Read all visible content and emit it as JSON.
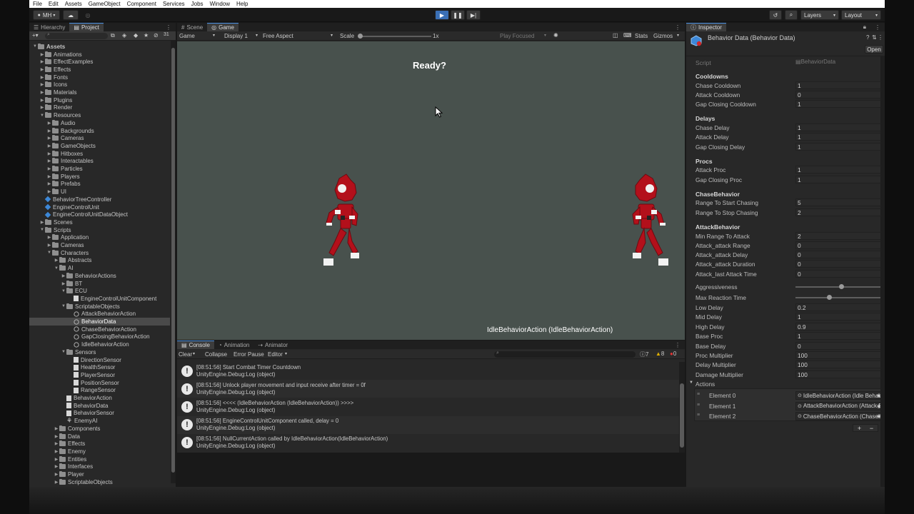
{
  "menu": [
    "File",
    "Edit",
    "Assets",
    "GameObject",
    "Component",
    "Services",
    "Jobs",
    "Window",
    "Help"
  ],
  "toolbar": {
    "account": "MH",
    "layers": "Layers",
    "layout": "Layout"
  },
  "left_tabs": {
    "hierarchy": "Hierarchy",
    "project": "Project"
  },
  "project_count": "31",
  "tree": [
    {
      "label": "Assets",
      "d": 0,
      "open": true,
      "icon": "folder",
      "bold": true
    },
    {
      "label": "Animations",
      "d": 1,
      "icon": "folder"
    },
    {
      "label": "EffectExamples",
      "d": 1,
      "icon": "folder"
    },
    {
      "label": "Effects",
      "d": 1,
      "icon": "folder"
    },
    {
      "label": "Fonts",
      "d": 1,
      "icon": "folder"
    },
    {
      "label": "Icons",
      "d": 1,
      "icon": "folder"
    },
    {
      "label": "Materials",
      "d": 1,
      "icon": "folder"
    },
    {
      "label": "Plugins",
      "d": 1,
      "icon": "folder"
    },
    {
      "label": "Render",
      "d": 1,
      "icon": "folder"
    },
    {
      "label": "Resources",
      "d": 1,
      "open": true,
      "icon": "folder"
    },
    {
      "label": "Audio",
      "d": 2,
      "icon": "folder"
    },
    {
      "label": "Backgrounds",
      "d": 2,
      "icon": "folder"
    },
    {
      "label": "Cameras",
      "d": 2,
      "icon": "folder"
    },
    {
      "label": "GameObjects",
      "d": 2,
      "icon": "folder"
    },
    {
      "label": "Hitboxes",
      "d": 2,
      "icon": "folder"
    },
    {
      "label": "Interactables",
      "d": 2,
      "icon": "folder"
    },
    {
      "label": "Particles",
      "d": 2,
      "icon": "folder"
    },
    {
      "label": "Players",
      "d": 2,
      "icon": "folder"
    },
    {
      "label": "Prefabs",
      "d": 2,
      "icon": "folder"
    },
    {
      "label": "UI",
      "d": 2,
      "icon": "folder"
    },
    {
      "label": "BehaviorTreeController",
      "d": 1,
      "icon": "cube",
      "leaf": true
    },
    {
      "label": "EngineControlUnit",
      "d": 1,
      "icon": "cube",
      "leaf": true
    },
    {
      "label": "EngineControlUnitDataObject",
      "d": 1,
      "icon": "cube",
      "leaf": true
    },
    {
      "label": "Scenes",
      "d": 1,
      "icon": "folder"
    },
    {
      "label": "Scripts",
      "d": 1,
      "open": true,
      "icon": "folder"
    },
    {
      "label": "Application",
      "d": 2,
      "icon": "folder"
    },
    {
      "label": "Cameras",
      "d": 2,
      "icon": "folder"
    },
    {
      "label": "Characters",
      "d": 2,
      "open": true,
      "icon": "folder"
    },
    {
      "label": "Abstracts",
      "d": 3,
      "icon": "folder"
    },
    {
      "label": "AI",
      "d": 3,
      "open": true,
      "icon": "folder"
    },
    {
      "label": "BehaviorActions",
      "d": 4,
      "icon": "folder"
    },
    {
      "label": "BT",
      "d": 4,
      "icon": "folder"
    },
    {
      "label": "ECU",
      "d": 4,
      "open": true,
      "icon": "folder"
    },
    {
      "label": "EngineControlUnitComponent",
      "d": 5,
      "icon": "file",
      "leaf": true
    },
    {
      "label": "ScriptableObjects",
      "d": 4,
      "open": true,
      "icon": "folder"
    },
    {
      "label": "AttackBehaviorAction",
      "d": 5,
      "icon": "so",
      "leaf": true
    },
    {
      "label": "BehaviorData",
      "d": 5,
      "icon": "so",
      "leaf": true,
      "sel": true
    },
    {
      "label": "ChaseBehaviorAction",
      "d": 5,
      "icon": "so",
      "leaf": true
    },
    {
      "label": "GapClosingBehaviorAction",
      "d": 5,
      "icon": "so",
      "leaf": true
    },
    {
      "label": "IdleBehaviorAction",
      "d": 5,
      "icon": "so",
      "leaf": true
    },
    {
      "label": "Sensors",
      "d": 4,
      "open": true,
      "icon": "folder"
    },
    {
      "label": "DirectionSensor",
      "d": 5,
      "icon": "file",
      "leaf": true
    },
    {
      "label": "HealthSensor",
      "d": 5,
      "icon": "file",
      "leaf": true
    },
    {
      "label": "PlayerSensor",
      "d": 5,
      "icon": "file",
      "leaf": true
    },
    {
      "label": "PositionSensor",
      "d": 5,
      "icon": "file",
      "leaf": true
    },
    {
      "label": "RangeSensor",
      "d": 5,
      "icon": "file",
      "leaf": true
    },
    {
      "label": "BehaviorAction",
      "d": 4,
      "icon": "file",
      "leaf": true
    },
    {
      "label": "BehaviorData",
      "d": 4,
      "icon": "file",
      "leaf": true
    },
    {
      "label": "BehaviorSensor",
      "d": 4,
      "icon": "file",
      "leaf": true
    },
    {
      "label": "EnemyAI",
      "d": 4,
      "icon": "prefab",
      "leaf": true
    },
    {
      "label": "Components",
      "d": 3,
      "icon": "folder"
    },
    {
      "label": "Data",
      "d": 3,
      "icon": "folder"
    },
    {
      "label": "Effects",
      "d": 3,
      "icon": "folder"
    },
    {
      "label": "Enemy",
      "d": 3,
      "icon": "folder"
    },
    {
      "label": "Entities",
      "d": 3,
      "icon": "folder"
    },
    {
      "label": "Interfaces",
      "d": 3,
      "icon": "folder"
    },
    {
      "label": "Player",
      "d": 3,
      "icon": "folder"
    },
    {
      "label": "ScriptableObjects",
      "d": 3,
      "icon": "folder"
    }
  ],
  "center_tabs": {
    "scene": "Scene",
    "game": "Game"
  },
  "game_toolbar": {
    "mode": "Game",
    "display": "Display 1",
    "aspect": "Free Aspect",
    "scale_label": "Scale",
    "scale_value": "1x",
    "play_focused": "Play Focused",
    "stats": "Stats",
    "gizmos": "Gizmos"
  },
  "scale_level": 0.0,
  "game": {
    "ready_text": "Ready?",
    "action_text": "IdleBehaviorAction (IdleBehaviorAction)"
  },
  "console_tabs": {
    "console": "Console",
    "animation": "Animation",
    "animator": "Animator"
  },
  "console_toolbar": {
    "clear": "Clear",
    "collapse": "Collapse",
    "error_pause": "Error Pause",
    "editor": "Editor",
    "warn_count": "7",
    "info_count": "8",
    "error_count": "0"
  },
  "logs": [
    {
      "l1": "[08:51:56] Start Combat Timer Countdown",
      "l2": "UnityEngine.Debug:Log (object)"
    },
    {
      "l1": "[08:51:56] Unlock player movement and input receive after timer = 0f",
      "l2": "UnityEngine.Debug:Log (object)"
    },
    {
      "l1": "[08:51:56] <<<< (IdleBehaviorAction (IdleBehaviorAction)) >>>>",
      "l2": "UnityEngine.Debug:Log (object)"
    },
    {
      "l1": "[08:51:56] EngineControlUnitComponent called, delay = 0",
      "l2": "UnityEngine.Debug:Log (object)"
    },
    {
      "l1": "[08:51:56] NullCurrentAction called by IdleBehaviorAction(IdleBehaviorAction)",
      "l2": "UnityEngine.Debug:Log (object)"
    }
  ],
  "inspector": {
    "tab": "Inspector",
    "title": "Behavior Data (Behavior Data)",
    "open_btn": "Open",
    "script_label": "Script",
    "script_value": "BehaviorData",
    "sections": [
      {
        "header": "Cooldowns",
        "fields": [
          {
            "label": "Chase Cooldown",
            "value": "1"
          },
          {
            "label": "Attack Cooldown",
            "value": "0"
          },
          {
            "label": "Gap Closing Cooldown",
            "value": "1"
          }
        ]
      },
      {
        "header": "Delays",
        "fields": [
          {
            "label": "Chase Delay",
            "value": "1"
          },
          {
            "label": "Attack Delay",
            "value": "1"
          },
          {
            "label": "Gap Closing Delay",
            "value": "1"
          }
        ]
      },
      {
        "header": "Procs",
        "fields": [
          {
            "label": "Attack Proc",
            "value": "1"
          },
          {
            "label": "Gap Closing Proc",
            "value": "1"
          }
        ]
      },
      {
        "header": "ChaseBehavior",
        "fields": [
          {
            "label": "Range To Start Chasing",
            "value": "5"
          },
          {
            "label": "Range To Stop Chasing",
            "value": "2"
          }
        ]
      },
      {
        "header": "AttackBehavior",
        "fields": [
          {
            "label": "Min Range To Attack",
            "value": "2"
          },
          {
            "label": "Attack_attack Range",
            "value": "0"
          },
          {
            "label": "Attack_attack Delay",
            "value": "0"
          },
          {
            "label": "Attack_attack Duration",
            "value": "0"
          },
          {
            "label": "Attack_last Attack Time",
            "value": "0"
          }
        ]
      }
    ],
    "sliders": [
      {
        "label": "Aggressiveness",
        "value": "0.5",
        "level": 0.5
      },
      {
        "label": "Max Reaction Time",
        "value": "1",
        "level": 0.37
      }
    ],
    "tail_fields": [
      {
        "label": "Low Delay",
        "value": "0.2"
      },
      {
        "label": "Mid Delay",
        "value": "1"
      },
      {
        "label": "High Delay",
        "value": "0.9"
      },
      {
        "label": "Base Proc",
        "value": "1"
      },
      {
        "label": "Base Delay",
        "value": "0"
      },
      {
        "label": "Proc Multiplier",
        "value": "100"
      },
      {
        "label": "Delay Multiplier",
        "value": "100"
      },
      {
        "label": "Damage Multiplier",
        "value": "100"
      }
    ],
    "actions_label": "Actions",
    "actions_count": "3",
    "elements": [
      {
        "label": "Element 0",
        "value": "IdleBehaviorAction (Idle Behavior Ac"
      },
      {
        "label": "Element 1",
        "value": "AttackBehaviorAction (Attack Behav"
      },
      {
        "label": "Element 2",
        "value": "ChaseBehaviorAction (Chase Behav"
      }
    ],
    "plus": "+",
    "minus": "−"
  },
  "colors": {
    "accent": "#4a90e2",
    "game_bg": "#48514d",
    "robot_red": "#b3101b"
  }
}
